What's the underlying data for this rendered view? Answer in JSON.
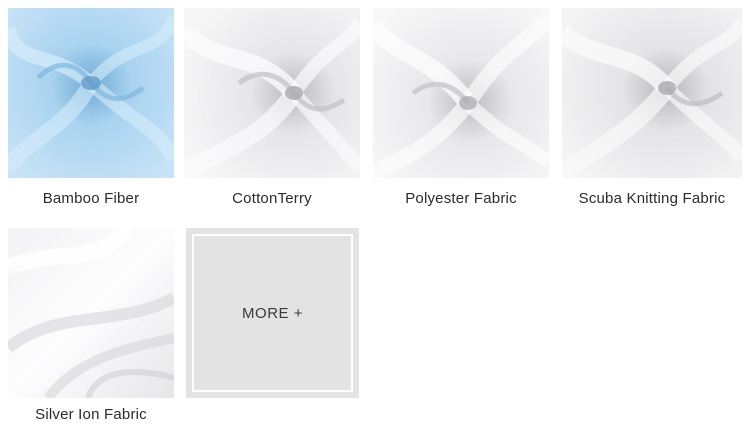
{
  "fabrics": [
    {
      "label": "Bamboo Fiber",
      "base": "#a9d3f0",
      "light": "#d6ecfb",
      "dark": "#7fb6df"
    },
    {
      "label": "CottonTerry",
      "base": "#ececed",
      "light": "#fbfbfc",
      "dark": "#bfc0c4"
    },
    {
      "label": "Polyester Fabric",
      "base": "#ededee",
      "light": "#fcfcfc",
      "dark": "#c2c2c6"
    },
    {
      "label": "Scuba Knitting Fabric",
      "base": "#eaeaeb",
      "light": "#fafafa",
      "dark": "#bdbdc0"
    },
    {
      "label": "Silver Ion Fabric",
      "base": "#f1f1f3",
      "light": "#ffffff",
      "dark": "#c9c9cf"
    }
  ],
  "more": {
    "label": "MORE +"
  }
}
